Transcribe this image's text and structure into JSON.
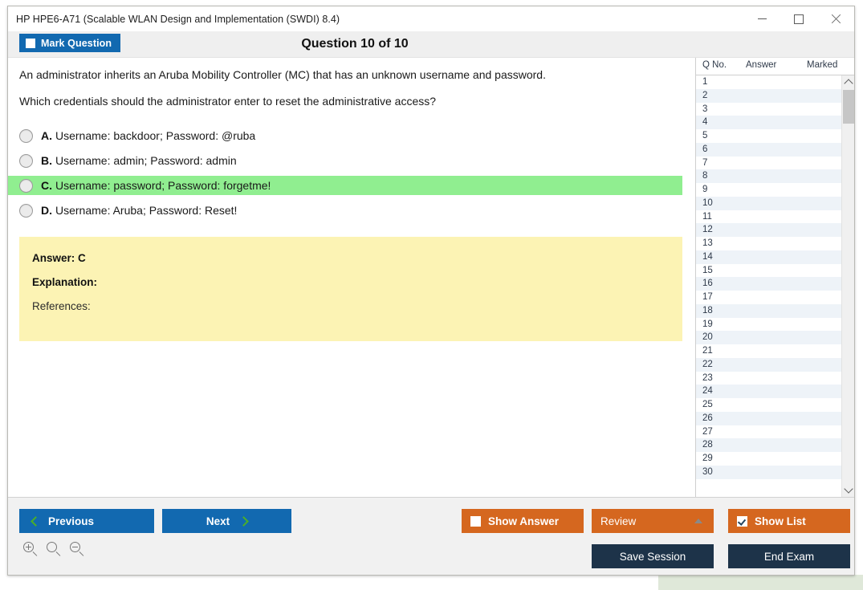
{
  "window": {
    "title": "HP HPE6-A71 (Scalable WLAN Design and Implementation (SWDI) 8.4)",
    "minimize_label": "Minimize",
    "maximize_label": "Maximize",
    "close_label": "Close"
  },
  "header": {
    "mark_question_label": "Mark Question",
    "question_counter": "Question 10 of 10"
  },
  "question": {
    "stem_line_1": "An administrator inherits an Aruba Mobility Controller (MC) that has an unknown username and password.",
    "stem_line_2": "Which credentials should the administrator enter to reset the administrative access?",
    "options": [
      {
        "letter": "A.",
        "text": "Username: backdoor; Password: @ruba",
        "selected": false,
        "highlighted": false
      },
      {
        "letter": "B.",
        "text": "Username: admin; Password: admin",
        "selected": false,
        "highlighted": false
      },
      {
        "letter": "C.",
        "text": "Username: password; Password: forgetme!",
        "selected": false,
        "highlighted": true
      },
      {
        "letter": "D.",
        "text": "Username: Aruba; Password: Reset!",
        "selected": false,
        "highlighted": false
      }
    ]
  },
  "answer_box": {
    "answer_label": "Answer: C",
    "explanation_label": "Explanation:",
    "references_label": "References:",
    "background_color": "#fcf3b4"
  },
  "question_list": {
    "columns": [
      "Q No.",
      "Answer",
      "Marked"
    ],
    "rows": [
      {
        "q_no": "1",
        "answer": "",
        "marked": ""
      },
      {
        "q_no": "2",
        "answer": "",
        "marked": ""
      },
      {
        "q_no": "3",
        "answer": "",
        "marked": ""
      },
      {
        "q_no": "4",
        "answer": "",
        "marked": ""
      },
      {
        "q_no": "5",
        "answer": "",
        "marked": ""
      },
      {
        "q_no": "6",
        "answer": "",
        "marked": ""
      },
      {
        "q_no": "7",
        "answer": "",
        "marked": ""
      },
      {
        "q_no": "8",
        "answer": "",
        "marked": ""
      },
      {
        "q_no": "9",
        "answer": "",
        "marked": ""
      },
      {
        "q_no": "10",
        "answer": "",
        "marked": ""
      },
      {
        "q_no": "11",
        "answer": "",
        "marked": ""
      },
      {
        "q_no": "12",
        "answer": "",
        "marked": ""
      },
      {
        "q_no": "13",
        "answer": "",
        "marked": ""
      },
      {
        "q_no": "14",
        "answer": "",
        "marked": ""
      },
      {
        "q_no": "15",
        "answer": "",
        "marked": ""
      },
      {
        "q_no": "16",
        "answer": "",
        "marked": ""
      },
      {
        "q_no": "17",
        "answer": "",
        "marked": ""
      },
      {
        "q_no": "18",
        "answer": "",
        "marked": ""
      },
      {
        "q_no": "19",
        "answer": "",
        "marked": ""
      },
      {
        "q_no": "20",
        "answer": "",
        "marked": ""
      },
      {
        "q_no": "21",
        "answer": "",
        "marked": ""
      },
      {
        "q_no": "22",
        "answer": "",
        "marked": ""
      },
      {
        "q_no": "23",
        "answer": "",
        "marked": ""
      },
      {
        "q_no": "24",
        "answer": "",
        "marked": ""
      },
      {
        "q_no": "25",
        "answer": "",
        "marked": ""
      },
      {
        "q_no": "26",
        "answer": "",
        "marked": ""
      },
      {
        "q_no": "27",
        "answer": "",
        "marked": ""
      },
      {
        "q_no": "28",
        "answer": "",
        "marked": ""
      },
      {
        "q_no": "29",
        "answer": "",
        "marked": ""
      },
      {
        "q_no": "30",
        "answer": "",
        "marked": ""
      }
    ]
  },
  "footer": {
    "previous_label": "Previous",
    "next_label": "Next",
    "show_answer_label": "Show Answer",
    "show_answer_checked": false,
    "review_label": "Review",
    "show_list_label": "Show List",
    "show_list_checked": true,
    "save_session_label": "Save Session",
    "end_exam_label": "End Exam",
    "zoom_in_label": "Zoom In",
    "zoom_reset_label": "Zoom Reset",
    "zoom_out_label": "Zoom Out"
  },
  "colors": {
    "primary_blue": "#1269b0",
    "accent_orange": "#d5671f",
    "navy": "#1d3349",
    "correct_green": "#90ee90",
    "chevron_green": "#4caf28",
    "highlight_yellow": "#fcf3b4"
  }
}
